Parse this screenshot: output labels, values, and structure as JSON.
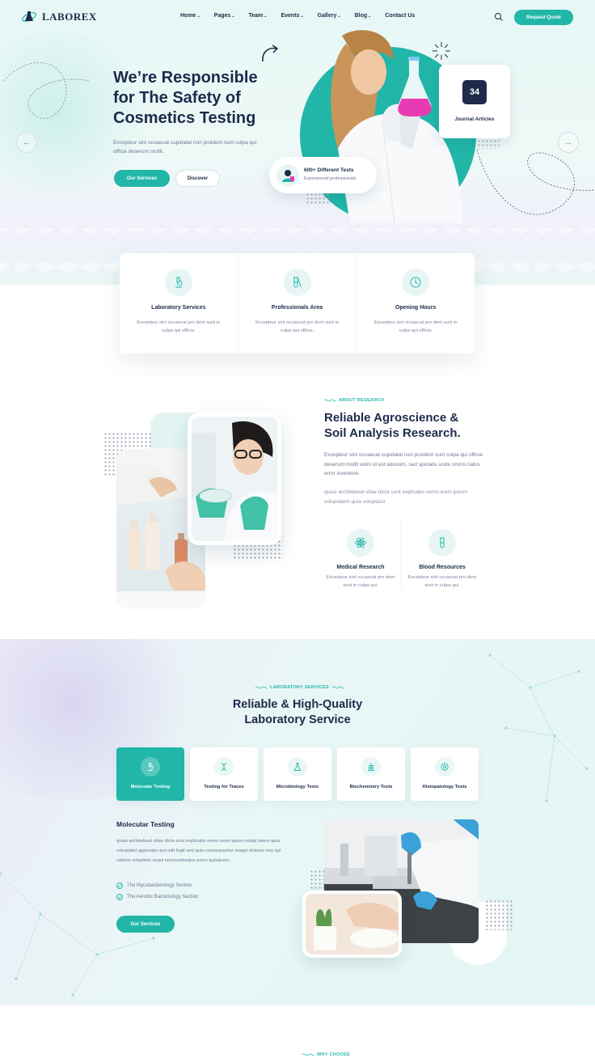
{
  "brand": {
    "name": "LABOREX",
    "accent": "#21b6a8",
    "navy": "#1d2a4a"
  },
  "nav": {
    "items": [
      {
        "label": "Home",
        "dropdown": true
      },
      {
        "label": "Pages",
        "dropdown": true
      },
      {
        "label": "Team",
        "dropdown": true
      },
      {
        "label": "Events",
        "dropdown": true
      },
      {
        "label": "Gallery",
        "dropdown": true
      },
      {
        "label": "Blog",
        "dropdown": true
      },
      {
        "label": "Contact Us",
        "dropdown": false
      }
    ],
    "cta": "Request Quote",
    "search_icon": "search-icon"
  },
  "hero": {
    "title_lines": [
      "We’re Responsible",
      "for The Safety of",
      "Cosmetics Testing"
    ],
    "text": "Excepteur sint occaecat cupidatat non proident sunt culpa qui officia deserunt mollit.",
    "primary_button": "Our Services",
    "secondary_button": "Discover",
    "journal": {
      "count": "34",
      "label": "Journal Articles"
    },
    "tests": {
      "title": "600+ Different Tests",
      "subtitle": "Experienced professionals"
    }
  },
  "features": [
    {
      "icon": "microscope-icon",
      "title": "Laboratory Services",
      "text": "Excepteur sint occaecat pro dent sunt in culpa qui officia."
    },
    {
      "icon": "test-tubes-icon",
      "title": "Professionals Area",
      "text": "Excepteur sint occaecat pro dent sunt in culpa qui officia."
    },
    {
      "icon": "clock-icon",
      "title": "Opening Hours",
      "text": "Excepteur sint occaecat pro dent sunt in culpa qui officia."
    }
  ],
  "about": {
    "eyebrow": "ABOUT RESEARCH",
    "title_lines": [
      "Reliable Agroscience &",
      "Soil Analysis Research."
    ],
    "paragraph1": "Excepteur sint occaecat cupidatat non proident sunt culpa qui officia deserunt mollit anim id est laborum, sed spiciatis unde omnis natus error inventore.",
    "paragraph2": "quasi architebeat vitae dicta sunt explicabo nemo enim ipsum voluptatem quia voluptasit.",
    "features": [
      {
        "icon": "atom-icon",
        "title": "Medical Research",
        "text": "Excepteur sint occaecat pro dent sunt in culpa qui."
      },
      {
        "icon": "test-tube-icon",
        "title": "Blood Resources",
        "text": "Excepteur sint occaecat pro dent sunt in culpa qui."
      }
    ]
  },
  "lab": {
    "eyebrow": "LABORATORY SERVICES",
    "title_lines": [
      "Reliable & High-Quality",
      "Laboratory Service"
    ],
    "tabs": [
      {
        "icon": "microscope-icon",
        "label": "Molecular Testing",
        "active": true
      },
      {
        "icon": "dna-icon",
        "label": "Testing for Traces",
        "active": false
      },
      {
        "icon": "flask-icon",
        "label": "Microbiology Tests",
        "active": false
      },
      {
        "icon": "lab-equipment-icon",
        "label": "Biochemistry Tests",
        "active": false
      },
      {
        "icon": "cell-icon",
        "label": "Histopatology Tests",
        "active": false
      }
    ],
    "panel": {
      "title": "Molecular Testing",
      "text": "quasi architebeat vitae dicta sunt explicabo nemo enim ipsum volup tatem quia voluptatet apperatur aut odit fugit sed quia consequuntur magni dolores eos qui ratione voluptem sequi nesciuntneque porro quisquam.",
      "checks": [
        "The Mycobacteriology Section",
        "The Aerobic Bacteriology Section"
      ],
      "button": "Our Services"
    }
  },
  "why": {
    "eyebrow": "WHY CHOOSE"
  }
}
